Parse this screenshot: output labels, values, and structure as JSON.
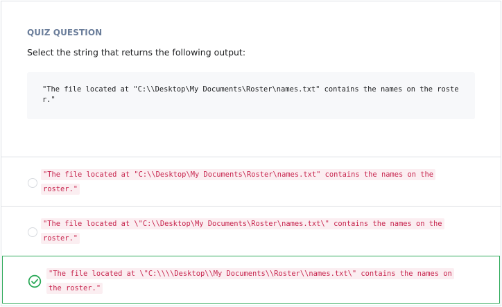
{
  "question": {
    "heading": "QUIZ QUESTION",
    "prompt": "Select the string that returns the following output:",
    "output_code": "\"The file located at \"C:\\\\Desktop\\My Documents\\Roster\\names.txt\" contains the names on the roster.\""
  },
  "options": [
    {
      "text": "\"The file located at \"C:\\\\Desktop\\My Documents\\Roster\\names.txt\" contains the names on the roster.\"",
      "selected": false
    },
    {
      "text": "\"The file located at \\\"C:\\\\Desktop\\My Documents\\Roster\\names.txt\\\" contains the names on the roster.\"",
      "selected": false
    },
    {
      "text": "\"The file located at \\\"C:\\\\\\\\Desktop\\\\My Documents\\\\Roster\\\\names.txt\\\" contains the names on the roster.\"",
      "selected": true
    }
  ],
  "colors": {
    "heading": "#6a7d9a",
    "code_text": "#c7254e",
    "code_bg": "#fbeef1",
    "selected_border": "#2eaa5a",
    "check": "#2eaa5a"
  },
  "icons": {
    "selected_option": "check-circle-icon",
    "unselected_option": "radio-empty"
  }
}
